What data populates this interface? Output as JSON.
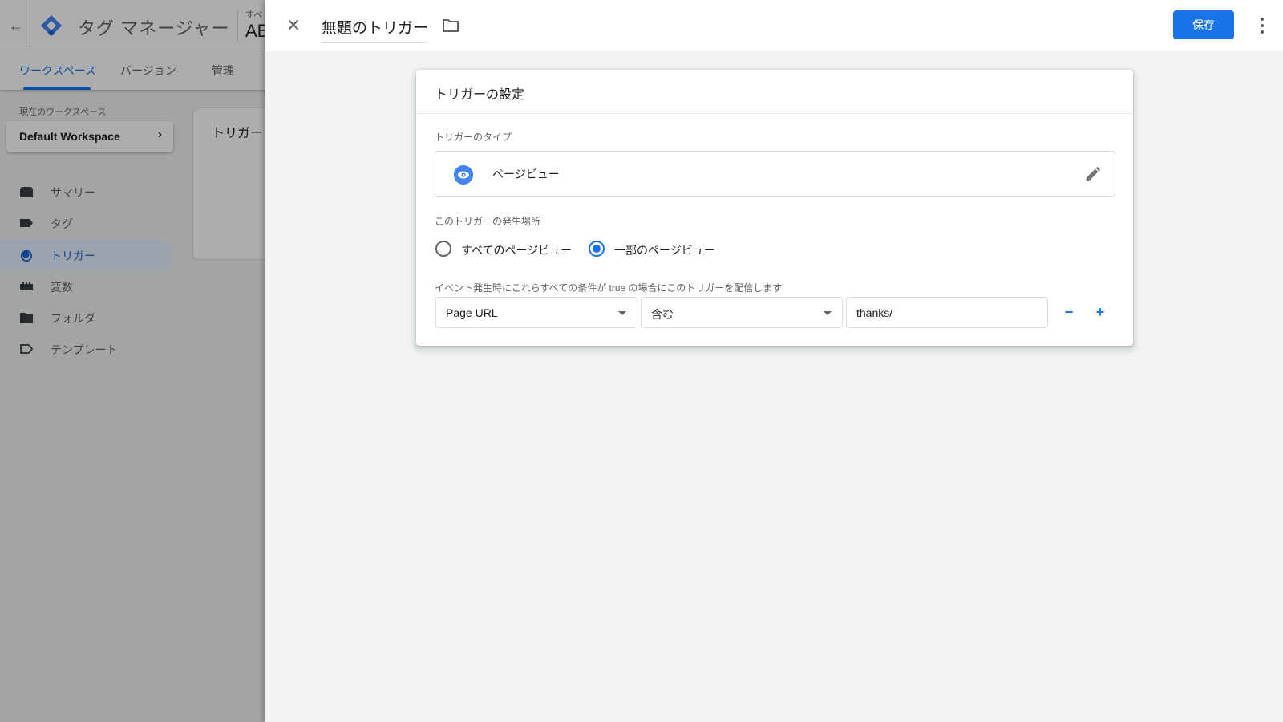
{
  "background_app": {
    "app_title": "タグ マネージャー",
    "account_sub": "すべ",
    "account_name": "AB",
    "tabs": [
      {
        "label": "ワークスペース",
        "active": true
      },
      {
        "label": "バージョン",
        "active": false
      },
      {
        "label": "管理",
        "active": false
      }
    ],
    "workspace_label": "現在のワークスペース",
    "workspace_name": "Default Workspace",
    "nav": [
      {
        "label": "サマリー",
        "icon": "summary-icon",
        "active": false
      },
      {
        "label": "タグ",
        "icon": "tag-icon",
        "active": false
      },
      {
        "label": "トリガー",
        "icon": "trigger-icon",
        "active": true
      },
      {
        "label": "変数",
        "icon": "variable-icon",
        "active": false
      },
      {
        "label": "フォルダ",
        "icon": "folder-icon",
        "active": false
      },
      {
        "label": "テンプレート",
        "icon": "template-icon",
        "active": false
      }
    ],
    "card_title": "トリガー"
  },
  "panel": {
    "title": "無題のトリガー",
    "save_label": "保存",
    "colors": {
      "accent": "#1a73e8",
      "trigger_icon": "#4285f4"
    }
  },
  "trigger_config": {
    "card_title": "トリガーの設定",
    "type_label": "トリガーのタイプ",
    "type_name": "ページビュー",
    "fire_on_label": "このトリガーの発生場所",
    "fire_on_options": [
      {
        "label": "すべてのページビュー",
        "checked": false
      },
      {
        "label": "一部のページビュー",
        "checked": true
      }
    ],
    "condition_label": "イベント発生時にこれらすべての条件が true の場合にこのトリガーを配信します",
    "condition": {
      "variable": "Page URL",
      "operator": "含む",
      "value": "thanks/"
    },
    "remove_label": "−",
    "add_label": "+"
  }
}
